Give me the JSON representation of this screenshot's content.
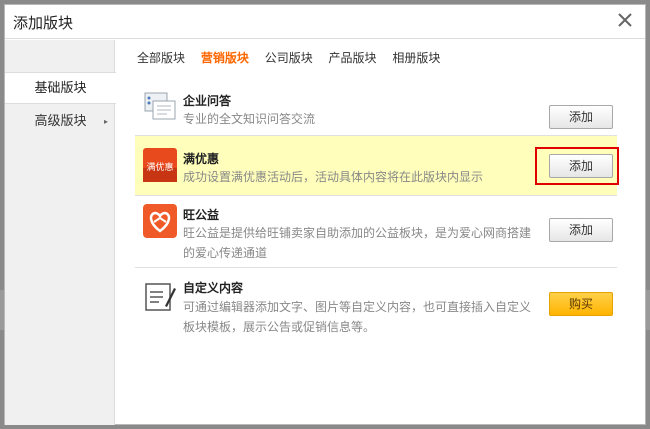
{
  "dialog": {
    "title": "添加版块"
  },
  "sidebar": {
    "items": [
      {
        "label": "基础版块",
        "active": true
      },
      {
        "label": "高级版块",
        "has_arrow": true,
        "arrow": "▸"
      }
    ]
  },
  "tabs": [
    {
      "label": "全部版块"
    },
    {
      "label": "营销版块",
      "active": true
    },
    {
      "label": "公司版块"
    },
    {
      "label": "产品版块"
    },
    {
      "label": "相册版块"
    }
  ],
  "modules": [
    {
      "name": "企业问答",
      "desc": "专业的全文知识问答交流",
      "button": "添加",
      "icon": "qa-icon"
    },
    {
      "name": "满优惠",
      "desc": "成功设置满优惠活动后，活动具体内容将在此版块内显示",
      "button": "添加",
      "icon": "discount-icon",
      "icon_text": "满优惠",
      "highlighted": true
    },
    {
      "name": "旺公益",
      "desc": "旺公益是提供给旺铺卖家自助添加的公益板块，是为爱心网商搭建的爱心传递通道",
      "button": "添加",
      "icon": "charity-heart-icon"
    },
    {
      "name": "自定义内容",
      "desc": "可通过编辑器添加文字、图片等自定义内容，也可直接插入自定义板块模板，展示公告或促销信息等。",
      "button": "购买",
      "icon": "edit-document-icon"
    }
  ],
  "colors": {
    "accent": "#ff6600",
    "highlight_bg": "#ffffbb",
    "buy_button": "#ffb400",
    "annotation_box": "#e00000"
  }
}
